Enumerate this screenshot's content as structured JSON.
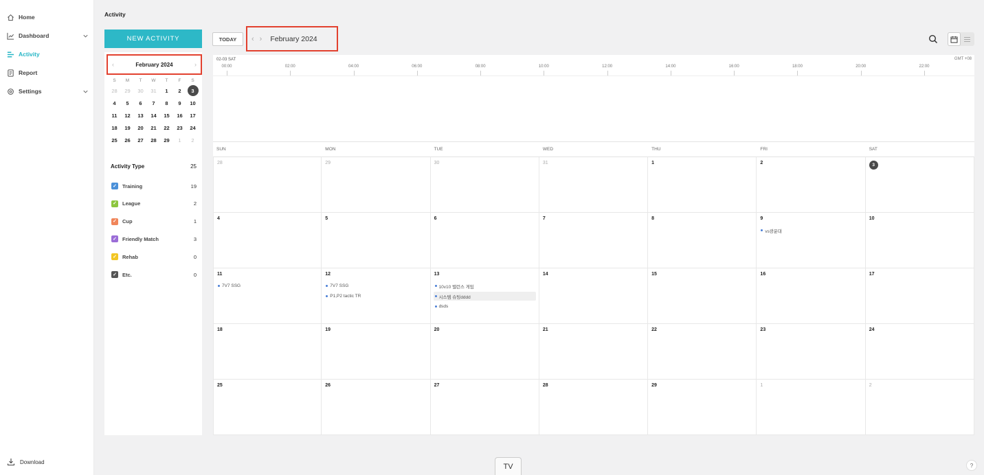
{
  "nav": {
    "items": [
      {
        "label": "Home",
        "icon": "home-icon"
      },
      {
        "label": "Dashboard",
        "icon": "chart-icon"
      },
      {
        "label": "Activity",
        "icon": "activity-icon"
      },
      {
        "label": "Report",
        "icon": "report-icon"
      },
      {
        "label": "Settings",
        "icon": "gear-icon"
      }
    ],
    "download_label": "Download"
  },
  "page_title": "Activity",
  "new_activity_label": "NEW ACTIVITY",
  "mini_calendar": {
    "title": "February 2024",
    "dow": [
      "S",
      "M",
      "T",
      "W",
      "T",
      "F",
      "S"
    ],
    "days": [
      "28",
      "29",
      "30",
      "31",
      "1",
      "2",
      "3",
      "4",
      "5",
      "6",
      "7",
      "8",
      "9",
      "10",
      "11",
      "12",
      "13",
      "14",
      "15",
      "16",
      "17",
      "18",
      "19",
      "20",
      "21",
      "22",
      "23",
      "24",
      "25",
      "26",
      "27",
      "28",
      "29",
      "1",
      "2"
    ]
  },
  "activity_type": {
    "label": "Activity Type",
    "total": "25",
    "items": [
      {
        "label": "Training",
        "count": "19",
        "color": "#4a90d9"
      },
      {
        "label": "League",
        "count": "2",
        "color": "#8dc63f"
      },
      {
        "label": "Cup",
        "count": "1",
        "color": "#f0855a"
      },
      {
        "label": "Friendly Match",
        "count": "3",
        "color": "#9b6dd7"
      },
      {
        "label": "Rehab",
        "count": "0",
        "color": "#f2c623"
      },
      {
        "label": "Etc.",
        "count": "0",
        "color": "#555555"
      }
    ]
  },
  "toolbar": {
    "today_label": "TODAY",
    "month_title": "February 2024"
  },
  "timeline": {
    "date": "02-03 SAT",
    "timezone": "GMT +08",
    "ticks": [
      "00:00",
      "02:00",
      "04:00",
      "06:00",
      "08:00",
      "10:00",
      "12:00",
      "14:00",
      "16:00",
      "18:00",
      "20:00",
      "22:00"
    ]
  },
  "calendar": {
    "dow": [
      "SUN",
      "MON",
      "TUE",
      "WED",
      "THU",
      "FRI",
      "SAT"
    ],
    "days": [
      {
        "n": "28",
        "muted": true
      },
      {
        "n": "29",
        "muted": true
      },
      {
        "n": "30",
        "muted": true
      },
      {
        "n": "31",
        "muted": true
      },
      {
        "n": "1"
      },
      {
        "n": "2"
      },
      {
        "n": "3",
        "today": true
      },
      {
        "n": "4"
      },
      {
        "n": "5"
      },
      {
        "n": "6"
      },
      {
        "n": "7"
      },
      {
        "n": "8"
      },
      {
        "n": "9",
        "events": [
          {
            "t": "vs광운대"
          }
        ]
      },
      {
        "n": "10"
      },
      {
        "n": "11",
        "events": [
          {
            "t": "7V7 SSG"
          }
        ]
      },
      {
        "n": "12",
        "events": [
          {
            "t": "7V7 SSG"
          },
          {
            "t": "P1,P2 tactic TR"
          }
        ]
      },
      {
        "n": "13",
        "events": [
          {
            "t": "10v10 밸런스 게임"
          },
          {
            "t": "시스템 슈팅dddd",
            "hl": true
          },
          {
            "t": "dsds"
          }
        ]
      },
      {
        "n": "14"
      },
      {
        "n": "15"
      },
      {
        "n": "16"
      },
      {
        "n": "17"
      },
      {
        "n": "18"
      },
      {
        "n": "19"
      },
      {
        "n": "20"
      },
      {
        "n": "21"
      },
      {
        "n": "22"
      },
      {
        "n": "23"
      },
      {
        "n": "24"
      },
      {
        "n": "25"
      },
      {
        "n": "26"
      },
      {
        "n": "27"
      },
      {
        "n": "28"
      },
      {
        "n": "29"
      },
      {
        "n": "1",
        "muted": true
      },
      {
        "n": "2",
        "muted": true
      }
    ]
  },
  "bottom": {
    "tv_label": "TV",
    "help_label": "?"
  }
}
